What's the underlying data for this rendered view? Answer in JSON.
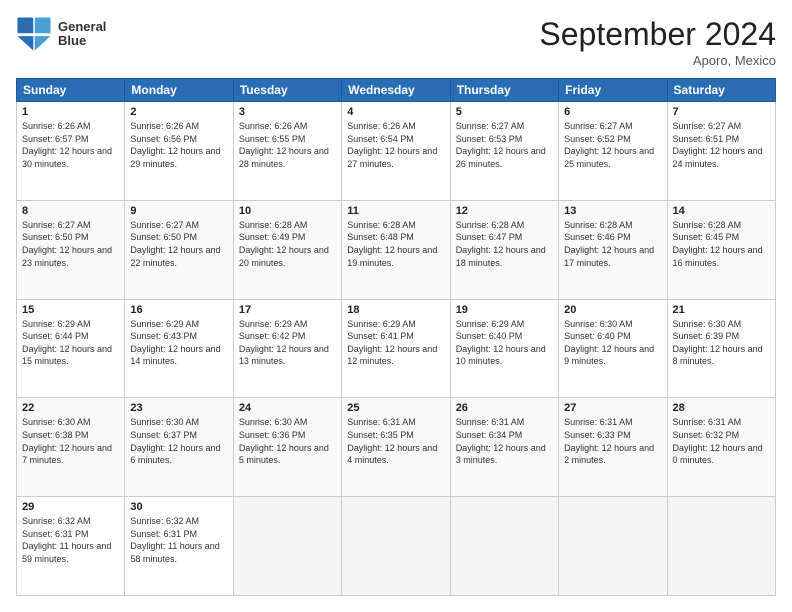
{
  "logo": {
    "line1": "General",
    "line2": "Blue"
  },
  "title": "September 2024",
  "location": "Aporo, Mexico",
  "days_of_week": [
    "Sunday",
    "Monday",
    "Tuesday",
    "Wednesday",
    "Thursday",
    "Friday",
    "Saturday"
  ],
  "weeks": [
    [
      {
        "day": "1",
        "sunrise": "6:26 AM",
        "sunset": "6:57 PM",
        "daylight": "12 hours and 30 minutes."
      },
      {
        "day": "2",
        "sunrise": "6:26 AM",
        "sunset": "6:56 PM",
        "daylight": "12 hours and 29 minutes."
      },
      {
        "day": "3",
        "sunrise": "6:26 AM",
        "sunset": "6:55 PM",
        "daylight": "12 hours and 28 minutes."
      },
      {
        "day": "4",
        "sunrise": "6:26 AM",
        "sunset": "6:54 PM",
        "daylight": "12 hours and 27 minutes."
      },
      {
        "day": "5",
        "sunrise": "6:27 AM",
        "sunset": "6:53 PM",
        "daylight": "12 hours and 26 minutes."
      },
      {
        "day": "6",
        "sunrise": "6:27 AM",
        "sunset": "6:52 PM",
        "daylight": "12 hours and 25 minutes."
      },
      {
        "day": "7",
        "sunrise": "6:27 AM",
        "sunset": "6:51 PM",
        "daylight": "12 hours and 24 minutes."
      }
    ],
    [
      {
        "day": "8",
        "sunrise": "6:27 AM",
        "sunset": "6:50 PM",
        "daylight": "12 hours and 23 minutes."
      },
      {
        "day": "9",
        "sunrise": "6:27 AM",
        "sunset": "6:50 PM",
        "daylight": "12 hours and 22 minutes."
      },
      {
        "day": "10",
        "sunrise": "6:28 AM",
        "sunset": "6:49 PM",
        "daylight": "12 hours and 20 minutes."
      },
      {
        "day": "11",
        "sunrise": "6:28 AM",
        "sunset": "6:48 PM",
        "daylight": "12 hours and 19 minutes."
      },
      {
        "day": "12",
        "sunrise": "6:28 AM",
        "sunset": "6:47 PM",
        "daylight": "12 hours and 18 minutes."
      },
      {
        "day": "13",
        "sunrise": "6:28 AM",
        "sunset": "6:46 PM",
        "daylight": "12 hours and 17 minutes."
      },
      {
        "day": "14",
        "sunrise": "6:28 AM",
        "sunset": "6:45 PM",
        "daylight": "12 hours and 16 minutes."
      }
    ],
    [
      {
        "day": "15",
        "sunrise": "6:29 AM",
        "sunset": "6:44 PM",
        "daylight": "12 hours and 15 minutes."
      },
      {
        "day": "16",
        "sunrise": "6:29 AM",
        "sunset": "6:43 PM",
        "daylight": "12 hours and 14 minutes."
      },
      {
        "day": "17",
        "sunrise": "6:29 AM",
        "sunset": "6:42 PM",
        "daylight": "12 hours and 13 minutes."
      },
      {
        "day": "18",
        "sunrise": "6:29 AM",
        "sunset": "6:41 PM",
        "daylight": "12 hours and 12 minutes."
      },
      {
        "day": "19",
        "sunrise": "6:29 AM",
        "sunset": "6:40 PM",
        "daylight": "12 hours and 10 minutes."
      },
      {
        "day": "20",
        "sunrise": "6:30 AM",
        "sunset": "6:40 PM",
        "daylight": "12 hours and 9 minutes."
      },
      {
        "day": "21",
        "sunrise": "6:30 AM",
        "sunset": "6:39 PM",
        "daylight": "12 hours and 8 minutes."
      }
    ],
    [
      {
        "day": "22",
        "sunrise": "6:30 AM",
        "sunset": "6:38 PM",
        "daylight": "12 hours and 7 minutes."
      },
      {
        "day": "23",
        "sunrise": "6:30 AM",
        "sunset": "6:37 PM",
        "daylight": "12 hours and 6 minutes."
      },
      {
        "day": "24",
        "sunrise": "6:30 AM",
        "sunset": "6:36 PM",
        "daylight": "12 hours and 5 minutes."
      },
      {
        "day": "25",
        "sunrise": "6:31 AM",
        "sunset": "6:35 PM",
        "daylight": "12 hours and 4 minutes."
      },
      {
        "day": "26",
        "sunrise": "6:31 AM",
        "sunset": "6:34 PM",
        "daylight": "12 hours and 3 minutes."
      },
      {
        "day": "27",
        "sunrise": "6:31 AM",
        "sunset": "6:33 PM",
        "daylight": "12 hours and 2 minutes."
      },
      {
        "day": "28",
        "sunrise": "6:31 AM",
        "sunset": "6:32 PM",
        "daylight": "12 hours and 0 minutes."
      }
    ],
    [
      {
        "day": "29",
        "sunrise": "6:32 AM",
        "sunset": "6:31 PM",
        "daylight": "11 hours and 59 minutes."
      },
      {
        "day": "30",
        "sunrise": "6:32 AM",
        "sunset": "6:31 PM",
        "daylight": "11 hours and 58 minutes."
      },
      null,
      null,
      null,
      null,
      null
    ]
  ]
}
